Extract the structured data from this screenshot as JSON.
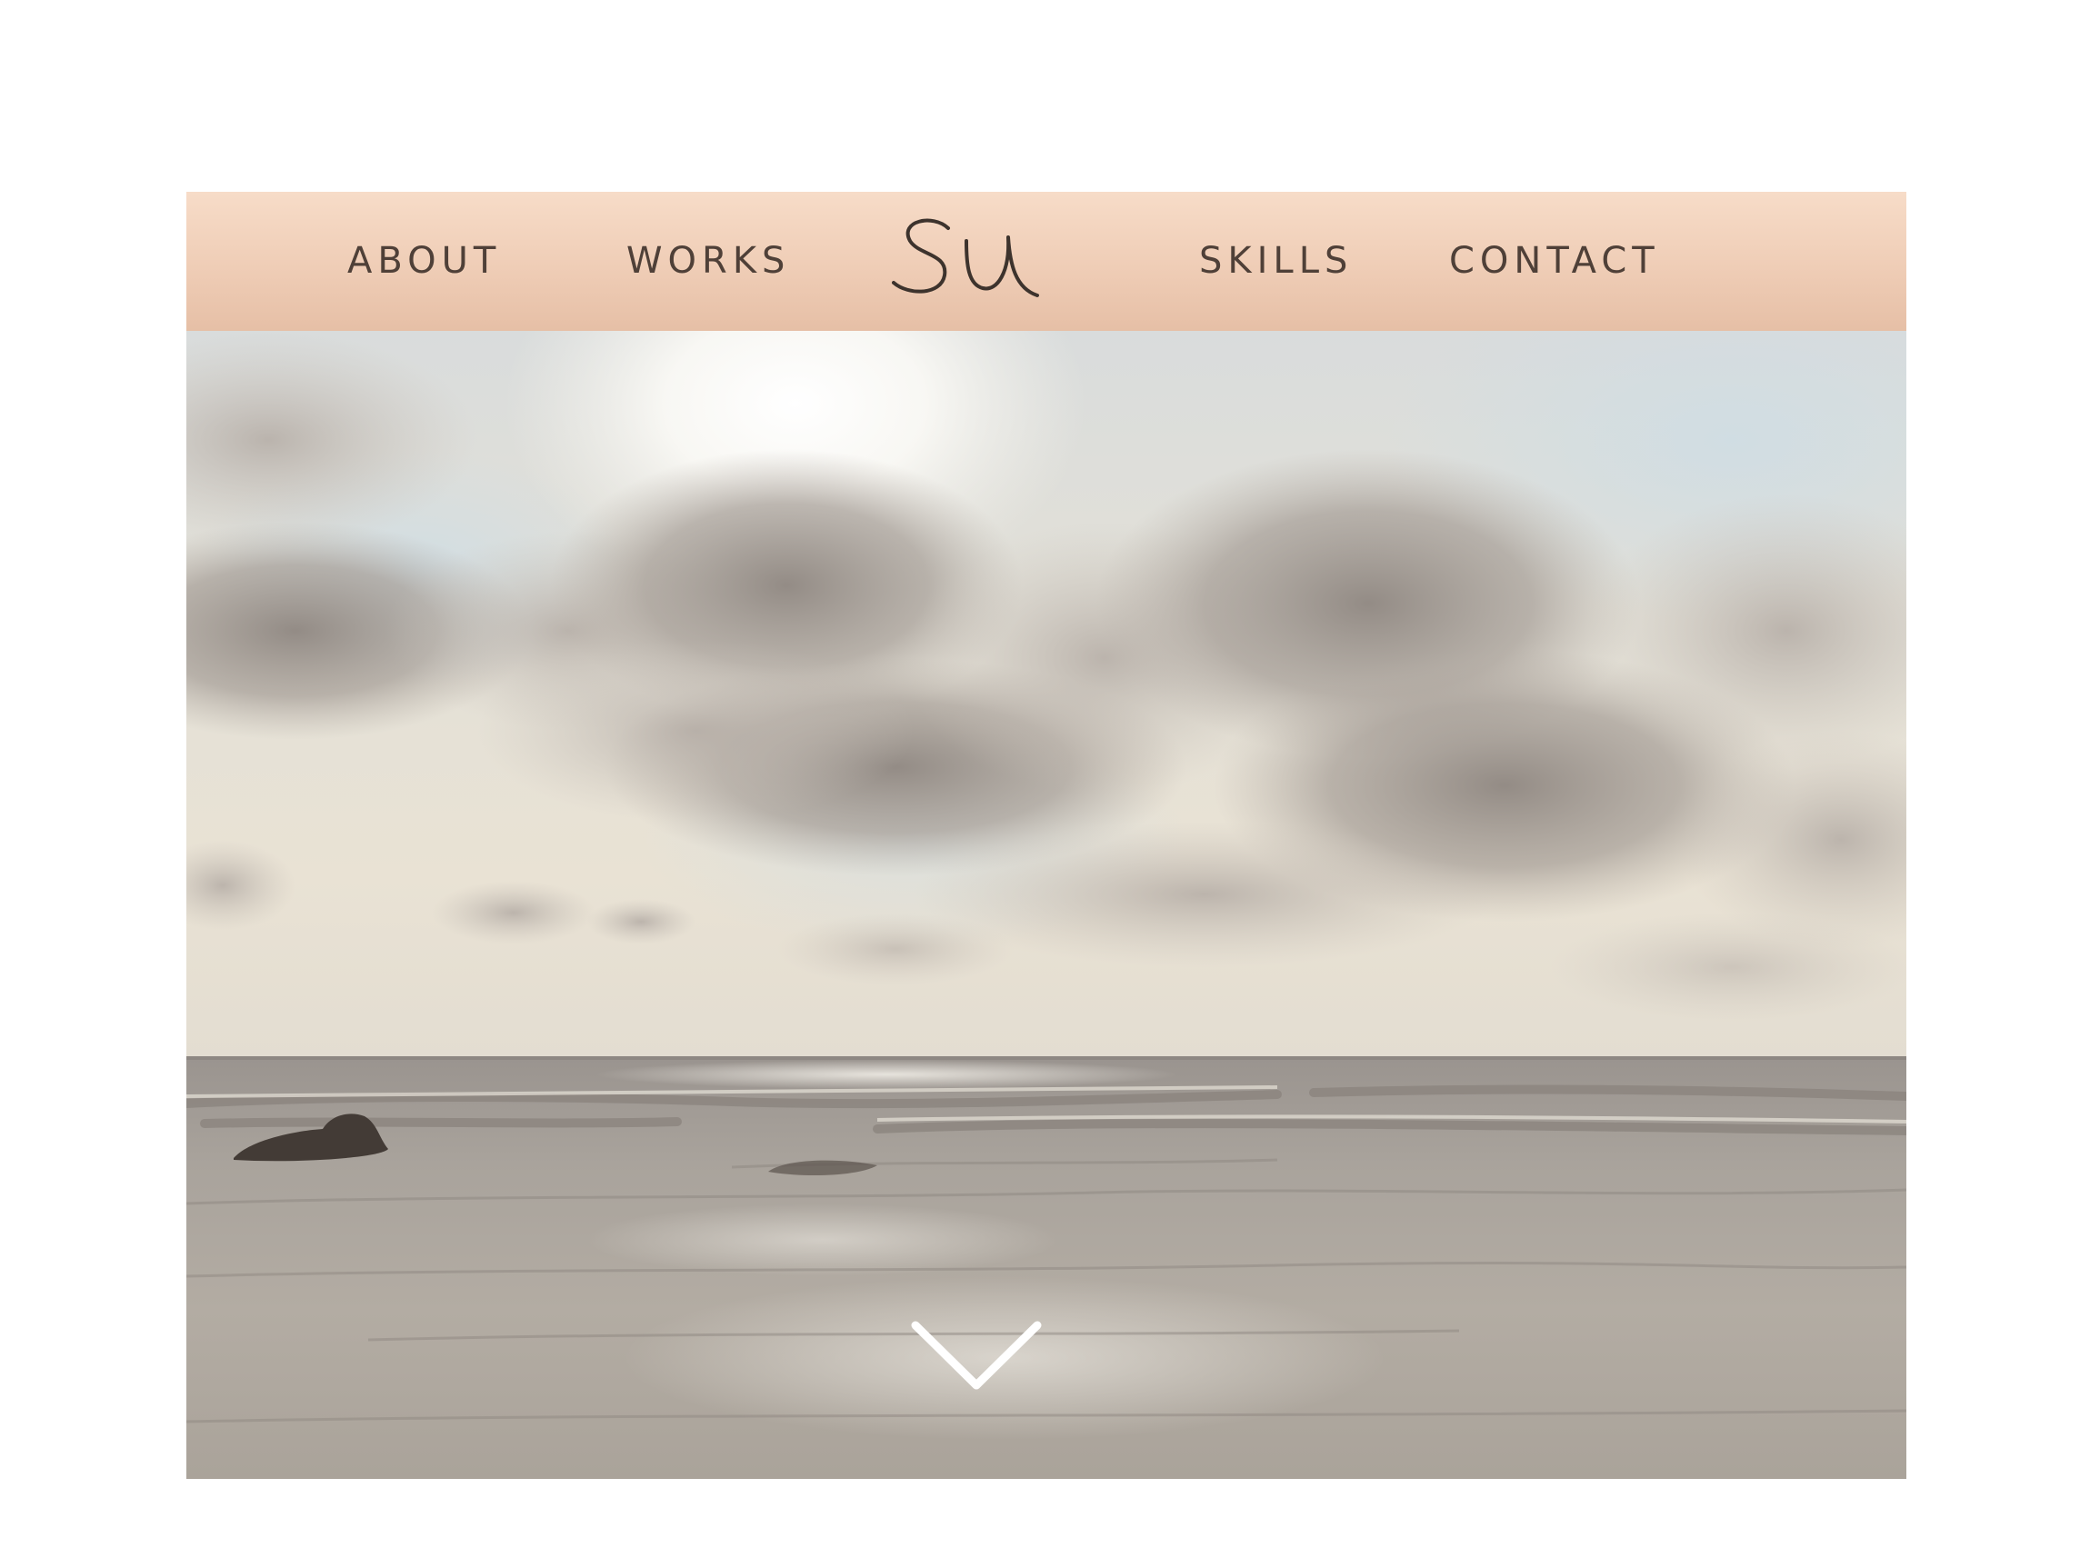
{
  "nav": {
    "left_items": [
      {
        "label": "ABOUT"
      },
      {
        "label": "WORKS"
      }
    ],
    "logo_text": "Su",
    "right_items": [
      {
        "label": "SKILLS"
      },
      {
        "label": "CONTACT"
      }
    ]
  },
  "hero": {
    "image_subject": "cloudy sky over the sea at a beach with a dark rock",
    "scroll_icon": "chevron-down-icon"
  },
  "colors": {
    "nav_top": "#f7dcc8",
    "nav_bottom": "#e6bfa6",
    "nav_text": "#4f4038",
    "logo_ink": "#3d332d",
    "chevron": "#ffffff"
  }
}
